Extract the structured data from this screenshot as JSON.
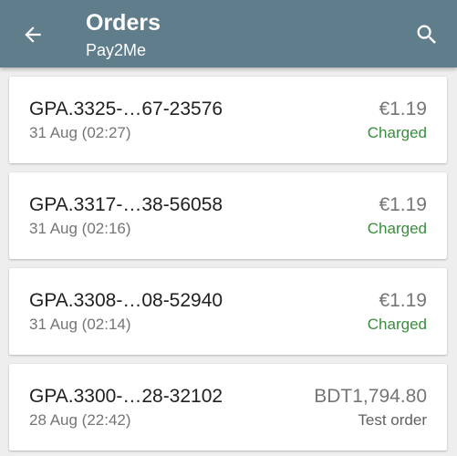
{
  "header": {
    "title": "Orders",
    "subtitle": "Pay2Me",
    "back_icon": "arrow-left-icon",
    "search_icon": "search-icon",
    "background_color": "#607d8b"
  },
  "colors": {
    "charged": "#388e3c",
    "test_order": "#616161"
  },
  "orders": [
    {
      "id": "GPA.3325-…67-23576",
      "date": "31 Aug (02:27)",
      "amount": "€1.19",
      "status": "Charged",
      "status_type": "charged"
    },
    {
      "id": "GPA.3317-…38-56058",
      "date": "31 Aug (02:16)",
      "amount": "€1.19",
      "status": "Charged",
      "status_type": "charged"
    },
    {
      "id": "GPA.3308-…08-52940",
      "date": "31 Aug (02:14)",
      "amount": "€1.19",
      "status": "Charged",
      "status_type": "charged"
    },
    {
      "id": "GPA.3300-…28-32102",
      "date": "28 Aug (22:42)",
      "amount": "BDT1,794.80",
      "status": "Test order",
      "status_type": "test_order"
    }
  ]
}
